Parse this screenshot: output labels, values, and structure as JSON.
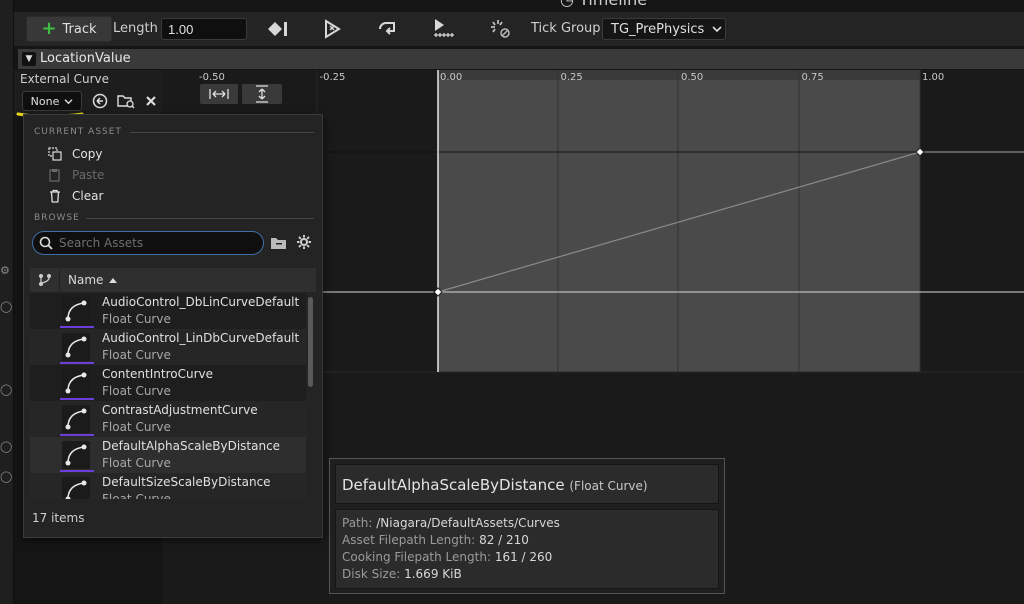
{
  "window": {
    "title": "Timeline"
  },
  "toolbar": {
    "track_button": "Track",
    "length_label": "Length",
    "length_value": "1.00",
    "tick_group_label": "Tick Group",
    "tick_group_value": "TG_PrePhysics"
  },
  "track": {
    "name": "LocationValue"
  },
  "external_curve": {
    "label": "External Curve",
    "combo_value": "None"
  },
  "curve_editor": {
    "x_ticks": [
      "-0.50",
      "-0.25",
      "0.00",
      "0.25",
      "0.50",
      "0.75",
      "1.00"
    ],
    "keys": [
      {
        "time": 0.0,
        "value": 0.0
      },
      {
        "time": 1.0,
        "value": 1.0
      }
    ]
  },
  "menu": {
    "current_asset_header": "CURRENT ASSET",
    "copy_label": "Copy",
    "paste_label": "Paste",
    "clear_label": "Clear",
    "browse_header": "BROWSE",
    "search_placeholder": "Search Assets",
    "name_column": "Name",
    "assets": [
      {
        "name": "AudioControl_DbLinCurveDefault",
        "type": "Float Curve"
      },
      {
        "name": "AudioControl_LinDbCurveDefault",
        "type": "Float Curve"
      },
      {
        "name": "ContentIntroCurve",
        "type": "Float Curve"
      },
      {
        "name": "ContrastAdjustmentCurve",
        "type": "Float Curve"
      },
      {
        "name": "DefaultAlphaScaleByDistance",
        "type": "Float Curve"
      },
      {
        "name": "DefaultSizeScaleByDistance",
        "type": "Float Curve"
      }
    ],
    "items_count": "17 items"
  },
  "tooltip": {
    "title": "DefaultAlphaScaleByDistance",
    "subtitle": "(Float Curve)",
    "path_label": "Path:",
    "path_value": "/Niagara/DefaultAssets/Curves",
    "asset_len_label": "Asset Filepath Length:",
    "asset_len_value": "82 / 210",
    "cook_len_label": "Cooking Filepath Length:",
    "cook_len_value": "161 / 260",
    "disk_label": "Disk Size:",
    "disk_value": "1.669 KiB"
  },
  "colors": {
    "accent_green": "#3fbf3f",
    "asset_underline": "#6b3fd8",
    "search_focus": "#3f6fa8",
    "annotation": "#f2e21a"
  }
}
